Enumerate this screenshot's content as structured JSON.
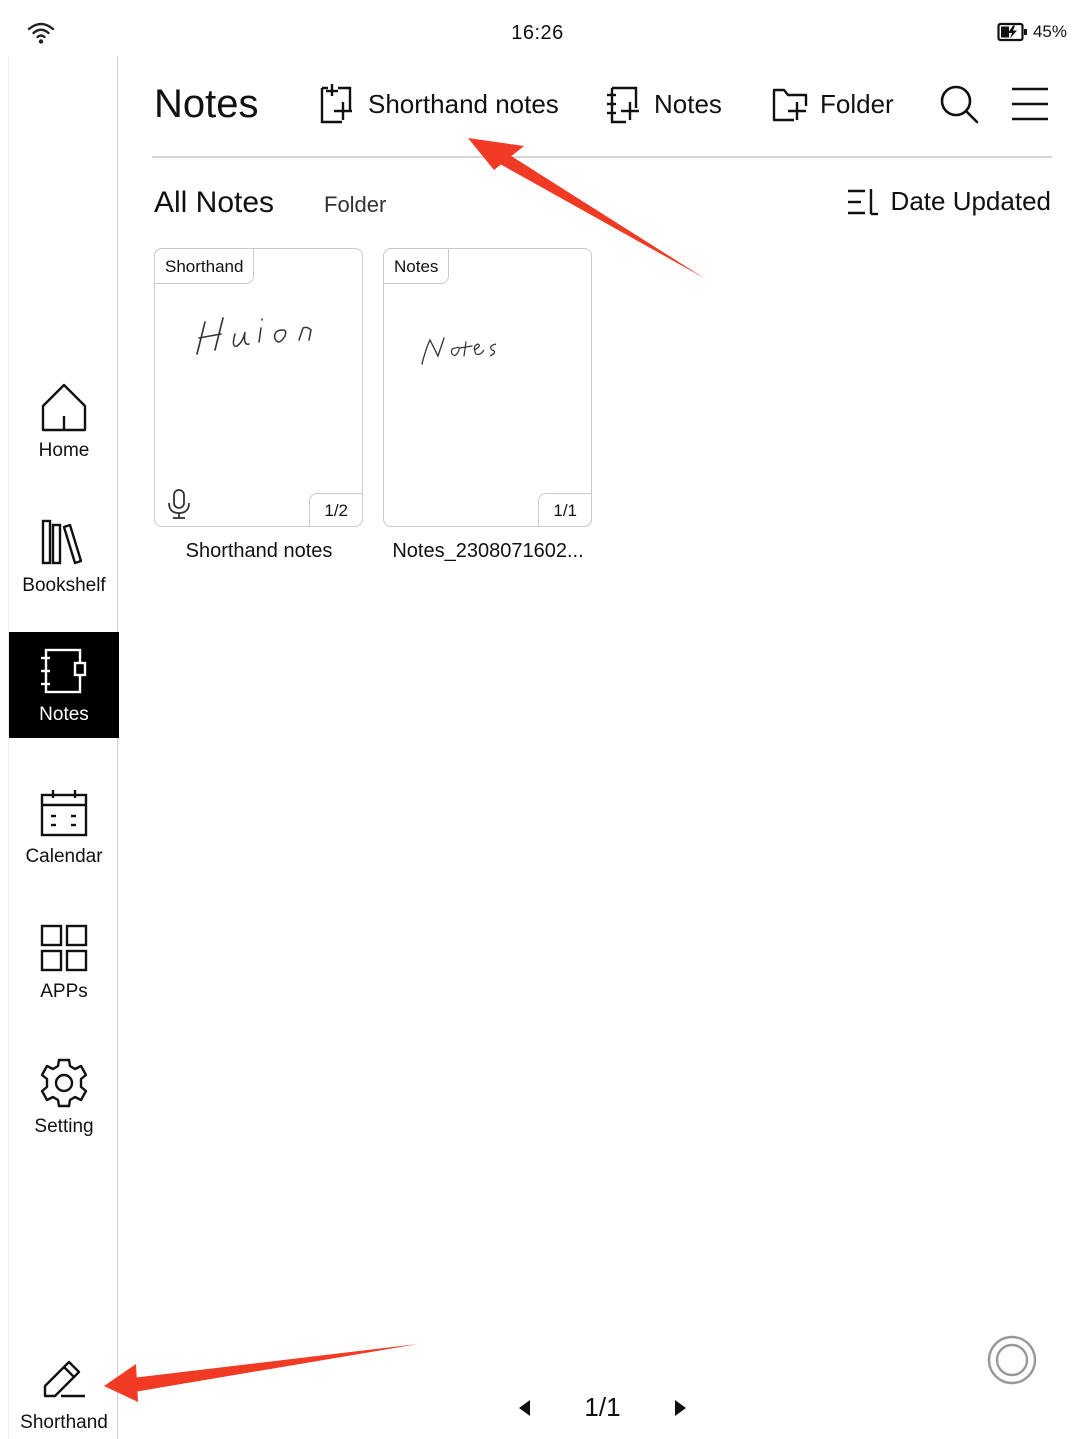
{
  "status_bar": {
    "time": "16:26",
    "battery": "45%"
  },
  "sidebar": {
    "items": [
      {
        "label": "Home",
        "icon": "home-icon"
      },
      {
        "label": "Bookshelf",
        "icon": "bookshelf-icon"
      },
      {
        "label": "Notes",
        "icon": "notebook-icon",
        "active": true
      },
      {
        "label": "Calendar",
        "icon": "calendar-icon"
      },
      {
        "label": "APPs",
        "icon": "apps-grid-icon"
      },
      {
        "label": "Setting",
        "icon": "gear-icon"
      }
    ],
    "shorthand_label": "Shorthand"
  },
  "header": {
    "title": "Notes",
    "shorthand_notes_label": "Shorthand notes",
    "notes_label": "Notes",
    "folder_label": "Folder"
  },
  "filters": {
    "all_notes": "All Notes",
    "folder": "Folder",
    "sort_label": "Date Updated"
  },
  "notes": [
    {
      "tag": "Shorthand",
      "page": "1/2",
      "name": "Shorthand notes",
      "handwriting": "Huion",
      "has_audio": true
    },
    {
      "tag": "Notes",
      "page": "1/1",
      "name": "Notes_2308071602...",
      "handwriting": "Notes",
      "has_audio": false
    }
  ],
  "pager": {
    "text": "1/1"
  },
  "colors": {
    "accent": "#000000",
    "annotation_arrow": "#f03a24",
    "divider": "#d6d6d6"
  }
}
